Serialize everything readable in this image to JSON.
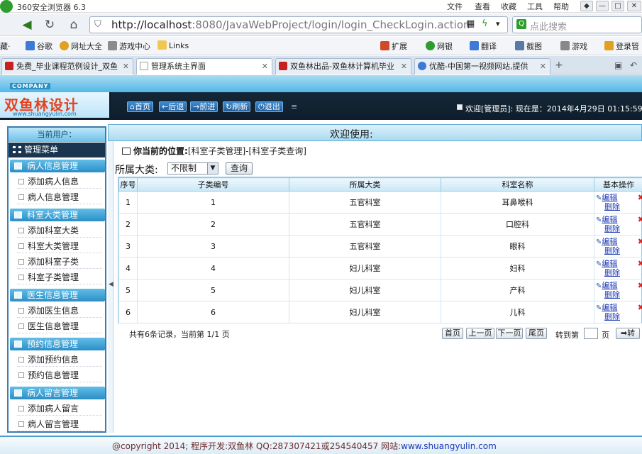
{
  "browser": {
    "title": "360安全浏览器 6.3",
    "menu": [
      "文件",
      "查看",
      "收藏",
      "工具",
      "帮助"
    ],
    "url_host": "http://localhost",
    "url_rest": ":8080/JavaWebProject/login/login_CheckLogin.action",
    "search_placeholder": "点此搜索",
    "favorites": [
      "藏·",
      "谷歌",
      "网址大全",
      "游戏中心",
      "Links"
    ],
    "toolbar_right": [
      "扩展",
      "网银",
      "翻译",
      "截图",
      "游戏",
      "登录管"
    ],
    "tabs": [
      "免费_毕业课程范例设计_双鱼",
      "管理系统主界面",
      "双鱼林出品-双鱼林计算机毕业",
      "优酷-中国第一视频网站,提供"
    ]
  },
  "header": {
    "company_tag": "COMPANY",
    "logo_title": "双鱼林设计",
    "logo_url": "www.shuangyulin.com",
    "nav": [
      "首页",
      "后退",
      "前进",
      "刷新",
      "退出"
    ],
    "welcome": "欢迎[管理员]:   现在是：2014年4月29日 01:15:59"
  },
  "sidebar": {
    "current_user": "当前用户：",
    "menu_title": "管理菜单",
    "groups": [
      {
        "title": "病人信息管理",
        "items": [
          "添加病人信息",
          "病人信息管理"
        ]
      },
      {
        "title": "科室大类管理",
        "items": [
          "添加科室大类",
          "科室大类管理",
          "添加科室子类",
          "科室子类管理"
        ]
      },
      {
        "title": "医生信息管理",
        "items": [
          "添加医生信息",
          "医生信息管理"
        ]
      },
      {
        "title": "预约信息管理",
        "items": [
          "添加预约信息",
          "预约信息管理"
        ]
      },
      {
        "title": "病人留言管理",
        "items": [
          "添加病人留言",
          "病人留言管理"
        ]
      }
    ]
  },
  "main": {
    "banner": "欢迎使用:",
    "breadcrumb_label": "你当前的位置:",
    "breadcrumb_path": "[科室子类管理]-[科室子类查询]",
    "filter_label": "所属大类:",
    "filter_value": "不限制",
    "query_button": "查询",
    "columns": [
      "序号",
      "子类编号",
      "所属大类",
      "科室名称",
      "基本操作"
    ],
    "rows": [
      [
        "1",
        "1",
        "五官科室",
        "耳鼻喉科"
      ],
      [
        "2",
        "2",
        "五官科室",
        "口腔科"
      ],
      [
        "3",
        "3",
        "五官科室",
        "眼科"
      ],
      [
        "4",
        "4",
        "妇儿科室",
        "妇科"
      ],
      [
        "5",
        "5",
        "妇儿科室",
        "产科"
      ],
      [
        "6",
        "6",
        "妇儿科室",
        "儿科"
      ]
    ],
    "edit_label": "编辑",
    "delete_label": "删除",
    "pager_info": "共有6条记录，当前第 1/1 页",
    "pager_buttons": [
      "首页",
      "上一页",
      "下一页",
      "尾页"
    ],
    "goto_label": "转到第",
    "page_suffix": "页",
    "go_button": "➡转"
  },
  "footer": {
    "text": "@copyright 2014; 程序开发:双鱼林  QQ:287307421或254540457  网站:",
    "link": "www.shuangyulin.com"
  }
}
